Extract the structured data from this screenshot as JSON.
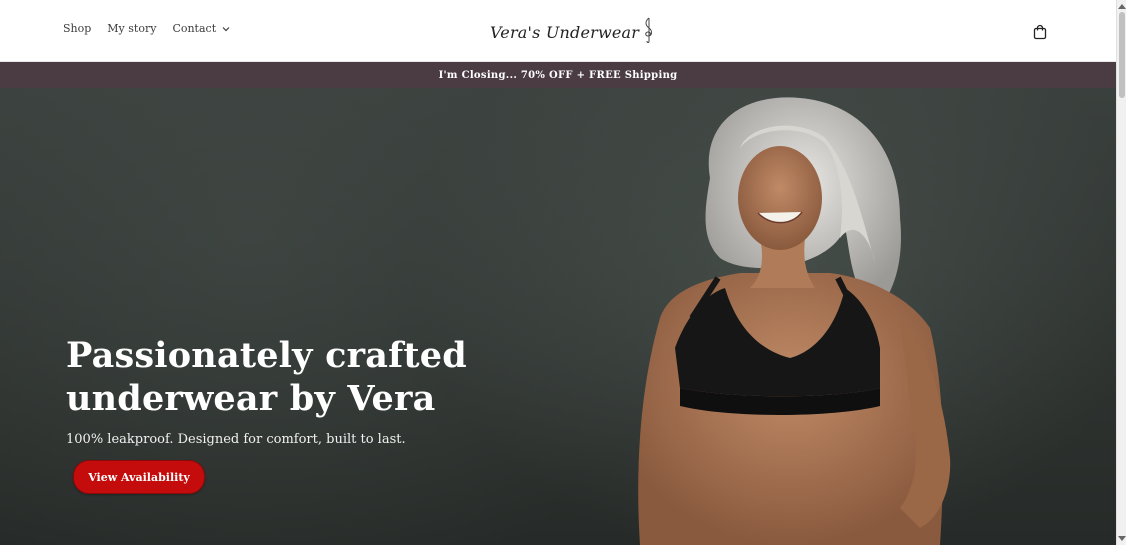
{
  "header": {
    "nav": [
      {
        "label": "Shop"
      },
      {
        "label": "My story"
      },
      {
        "label": "Contact",
        "has_dropdown": true
      }
    ],
    "brand": "Vera's Underwear",
    "cart_icon": "shopping-bag-icon"
  },
  "announcement": {
    "text": "I'm Closing... 70% OFF + FREE Shipping"
  },
  "hero": {
    "title": "Passionately crafted underwear by Vera",
    "subtitle": "100% leakproof. Designed for comfort, built to last.",
    "cta_label": "View Availability"
  },
  "colors": {
    "announcement_bg": "#4b3c44",
    "cta_bg": "#c40c0c",
    "hero_bg": "#333835"
  }
}
